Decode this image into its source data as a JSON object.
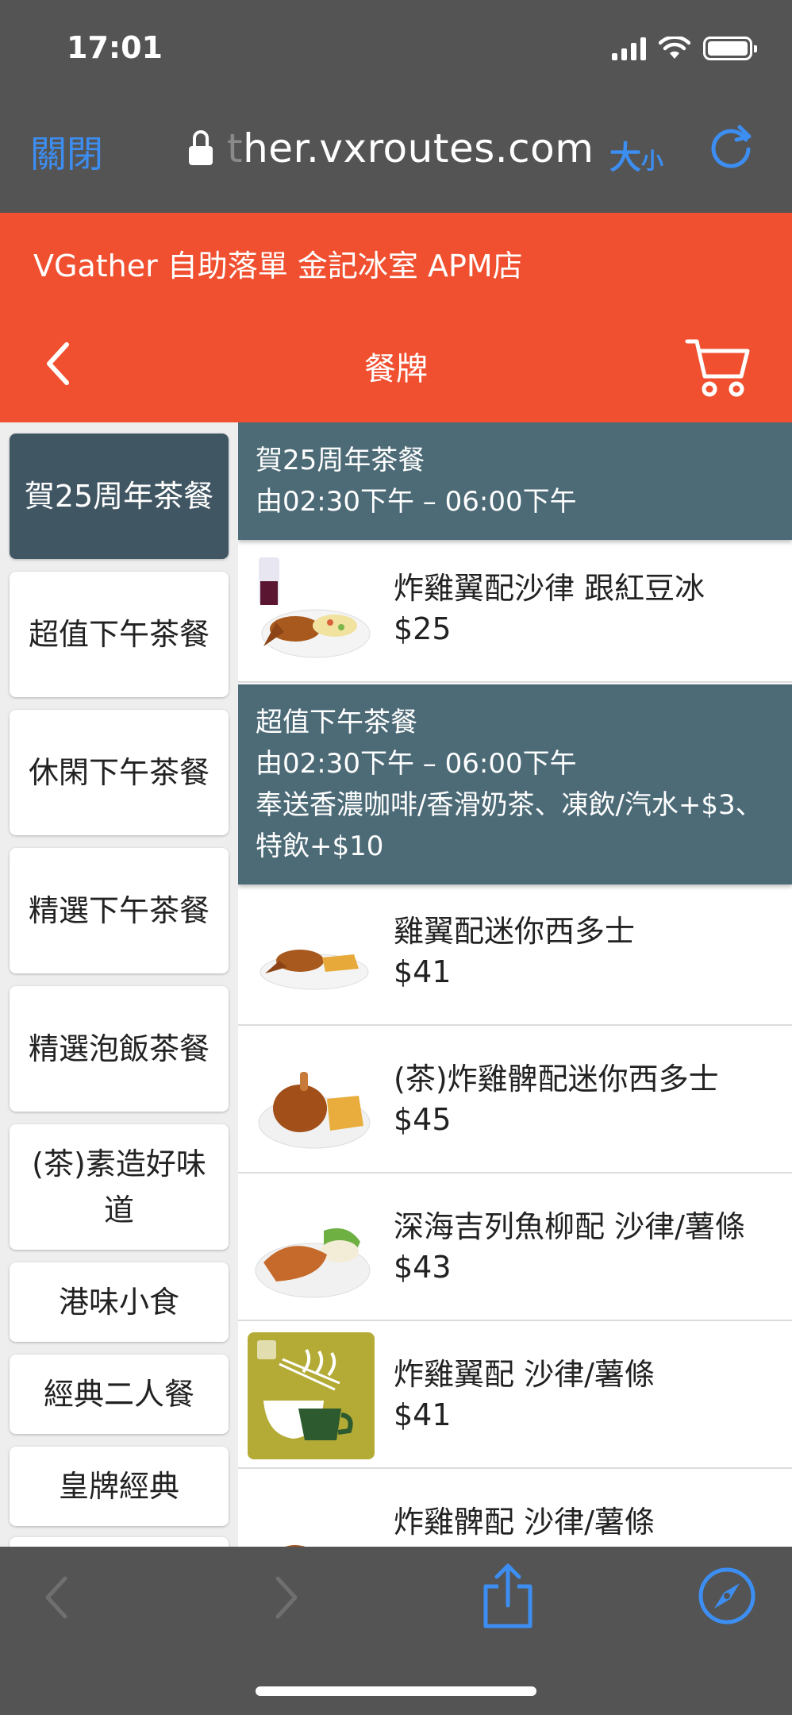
{
  "status_bar": {
    "time": "17:01"
  },
  "browser": {
    "close_label": "關閉",
    "url_faded": "t",
    "url": "her.vxroutes.com",
    "text_size_big": "大",
    "text_size_small": "小"
  },
  "header": {
    "store_name": "VGather 自助落單 金記冰室 APM店",
    "title": "餐牌"
  },
  "sidebar": {
    "items": [
      {
        "label": "賀25周年茶餐",
        "active": true
      },
      {
        "label": "超值下午茶餐"
      },
      {
        "label": "休閑下午茶餐"
      },
      {
        "label": "精選下午茶餐"
      },
      {
        "label": "精選泡飯茶餐"
      },
      {
        "label": "(茶)素造好味道"
      },
      {
        "label": "港味小食"
      },
      {
        "label": "經典二人餐"
      },
      {
        "label": "皇牌經典"
      }
    ]
  },
  "menu": {
    "sections": [
      {
        "title": "賀25周年茶餐",
        "hours": "由02:30下午 – 06:00下午",
        "note": ""
      },
      {
        "title": "超值下午茶餐",
        "hours": "由02:30下午 – 06:00下午",
        "note": "奉送香濃咖啡/香滑奶茶、凍飲/汽水+$3、特飲+$10"
      }
    ],
    "items": [
      {
        "name": "炸雞翼配沙律 跟紅豆冰",
        "price": "$25",
        "image": "wings-salad-redbean-photo"
      },
      {
        "name": "雞翼配迷你西多士",
        "price": "$41",
        "image": "wings-toast-photo"
      },
      {
        "name": "(茶)炸雞髀配迷你西多士",
        "price": "$45",
        "image": "drumstick-toast-photo"
      },
      {
        "name": "深海吉列魚柳配 沙律/薯條",
        "price": "$43",
        "image": "fish-fillet-photo"
      },
      {
        "name": "炸雞翼配 沙律/薯條",
        "price": "$41",
        "image": "kamkee-logo-placeholder"
      },
      {
        "name": "炸雞髀配 沙律/薯條",
        "price": "",
        "image": "drumstick-salad-photo"
      }
    ]
  },
  "colors": {
    "chrome": "#545454",
    "accent_blue": "#3d8ef2",
    "header": "#f05030",
    "section_header": "#4d6b77",
    "sidebar_active": "#415663"
  }
}
